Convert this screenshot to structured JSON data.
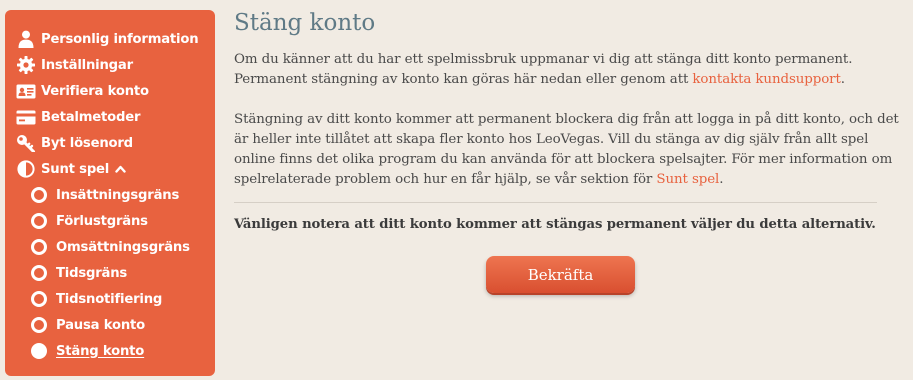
{
  "sidebar": {
    "items": [
      {
        "label": "Personlig information",
        "icon": "user-icon"
      },
      {
        "label": "Inställningar",
        "icon": "gear-icon"
      },
      {
        "label": "Verifiera konto",
        "icon": "id-card-icon"
      },
      {
        "label": "Betalmetoder",
        "icon": "credit-card-icon"
      },
      {
        "label": "Byt lösenord",
        "icon": "key-icon"
      },
      {
        "label": "Sunt spel",
        "icon": "half-circle-icon"
      }
    ],
    "sub_items": [
      {
        "label": "Insättningsgräns"
      },
      {
        "label": "Förlustgräns"
      },
      {
        "label": "Omsättningsgräns"
      },
      {
        "label": "Tidsgräns"
      },
      {
        "label": "Tidsnotifiering"
      },
      {
        "label": "Pausa konto"
      },
      {
        "label": "Stäng konto",
        "active": true
      }
    ]
  },
  "main": {
    "title": "Stäng konto",
    "para1_text": "Om du känner att du har ett spelmissbruk uppmanar vi dig att stänga ditt konto permanent. Permanent stängning av konto kan göras här nedan eller genom att ",
    "para1_link": "kontakta kundsupport",
    "para1_end": ".",
    "para2_text": "Stängning av ditt konto kommer att permanent blockera dig från att logga in på ditt konto, och det är heller inte tillåtet att skapa fler konto hos LeoVegas. Vill du stänga av dig själv från allt spel online finns det olika program du kan använda för att blockera spelsajter. För mer information om spelrelaterade problem och hur en får hjälp, se vår sektion för ",
    "para2_link": "Sunt spel",
    "para2_end": ".",
    "notice": "Vänligen notera att ditt konto kommer att stängas permanent väljer du detta alternativ.",
    "confirm_label": "Bekräfta"
  },
  "colors": {
    "accent": "#e8623f",
    "title": "#5f7a86",
    "background": "#f1ebe3"
  }
}
